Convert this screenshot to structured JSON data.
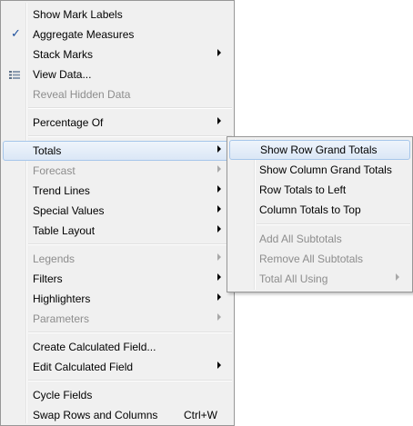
{
  "main_menu": {
    "items": [
      {
        "label": "Show Mark Labels"
      },
      {
        "label": "Aggregate Measures"
      },
      {
        "label": "Stack Marks"
      },
      {
        "label": "View Data..."
      },
      {
        "label": "Reveal Hidden Data"
      },
      {
        "label": "Percentage Of"
      },
      {
        "label": "Totals"
      },
      {
        "label": "Forecast"
      },
      {
        "label": "Trend Lines"
      },
      {
        "label": "Special Values"
      },
      {
        "label": "Table Layout"
      },
      {
        "label": "Legends"
      },
      {
        "label": "Filters"
      },
      {
        "label": "Highlighters"
      },
      {
        "label": "Parameters"
      },
      {
        "label": "Create Calculated Field..."
      },
      {
        "label": "Edit Calculated Field"
      },
      {
        "label": "Cycle Fields"
      },
      {
        "label": "Swap Rows and Columns",
        "shortcut": "Ctrl+W"
      }
    ],
    "check_glyph": "✓"
  },
  "totals_submenu": {
    "items": [
      {
        "label": "Show Row Grand Totals"
      },
      {
        "label": "Show Column Grand Totals"
      },
      {
        "label": "Row Totals to Left"
      },
      {
        "label": "Column Totals to Top"
      },
      {
        "label": "Add All Subtotals"
      },
      {
        "label": "Remove All Subtotals"
      },
      {
        "label": "Total All Using"
      }
    ]
  },
  "colors": {
    "menu_bg": "#f0f0f0",
    "hover_border": "#a6c6ea",
    "disabled_text": "#8d8d8d",
    "check": "#1c4f9c"
  }
}
